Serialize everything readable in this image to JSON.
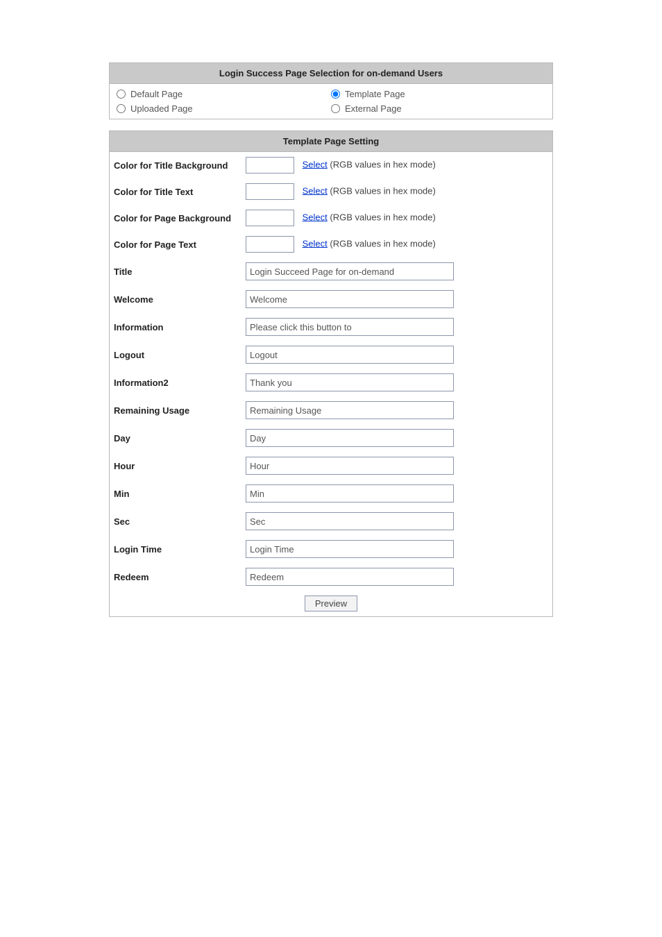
{
  "pageSelection": {
    "header": "Login Success Page Selection for on-demand Users",
    "options": {
      "default": "Default Page",
      "template": "Template Page",
      "uploaded": "Uploaded Page",
      "external": "External Page"
    },
    "selected": "template"
  },
  "templateSettings": {
    "header": "Template Page Setting",
    "selectLinkLabel": "Select",
    "hint": "(RGB values in hex mode)",
    "labels": {
      "colorTitleBg": "Color for Title Background",
      "colorTitleText": "Color for Title Text",
      "colorPageBg": "Color for Page Background",
      "colorPageText": "Color for Page Text",
      "title": "Title",
      "welcome": "Welcome",
      "information": "Information",
      "logout": "Logout",
      "information2": "Information2",
      "remaining": "Remaining Usage",
      "day": "Day",
      "hour": "Hour",
      "min": "Min",
      "sec": "Sec",
      "loginTime": "Login Time",
      "redeem": "Redeem"
    },
    "values": {
      "colorTitleBg": "",
      "colorTitleText": "",
      "colorPageBg": "",
      "colorPageText": "",
      "title": "Login Succeed Page for on-demand",
      "welcome": "Welcome",
      "information": "Please click this button to",
      "logout": "Logout",
      "information2": "Thank you",
      "remaining": "Remaining Usage",
      "day": "Day",
      "hour": "Hour",
      "min": "Min",
      "sec": "Sec",
      "loginTime": "Login Time",
      "redeem": "Redeem"
    },
    "previewLabel": "Preview"
  }
}
